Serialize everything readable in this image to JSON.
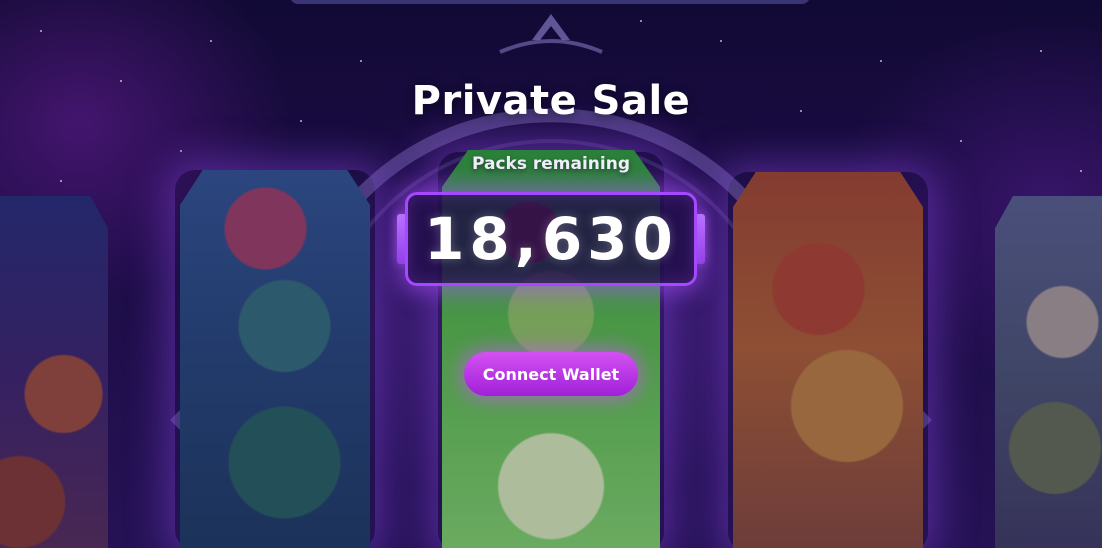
{
  "page": {
    "title": "Private Sale",
    "packs_label": "Packs remaining",
    "packs_remaining": "18,630",
    "connect_button_label": "Connect Wallet"
  },
  "colors": {
    "background": "#1c0c45",
    "accent": "#a548ff",
    "button": "#c03ae8",
    "text": "#ffffff"
  }
}
